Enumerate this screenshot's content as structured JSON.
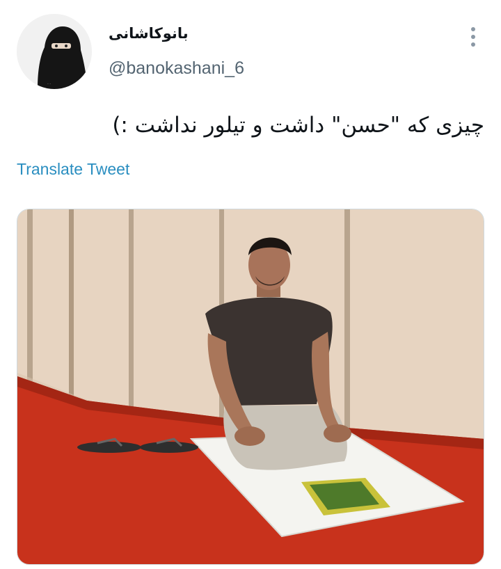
{
  "tweet": {
    "display_name": "بانوکاشانی",
    "handle": "@banokashani_6",
    "text": "چیزی که \"حسن\" داشت و تیلور نداشت :)",
    "translate_label": "Translate Tweet",
    "more_icon": "more-options-icon",
    "media_description_icon": "tweet-photo"
  },
  "colors": {
    "link": "#2a8ec0",
    "handle": "#536471",
    "text": "#0f1419",
    "carpet": "#c8321c",
    "wall": "#ead8c6"
  }
}
